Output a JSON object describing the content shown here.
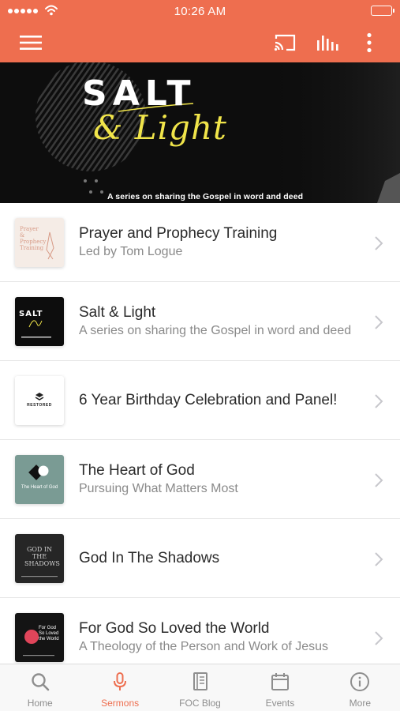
{
  "status_bar": {
    "time": "10:26 AM"
  },
  "banner": {
    "title": "SALT",
    "script": "& Light",
    "subtitle": "A series on sharing the Gospel in word and deed"
  },
  "sermons": [
    {
      "title": "Prayer and Prophecy Training",
      "subtitle": "Led by Tom Logue",
      "thumb_text": "Prayer & Prophecy Training"
    },
    {
      "title": "Salt & Light",
      "subtitle": "A series on sharing the Gospel in word and deed",
      "thumb_text": "SALT"
    },
    {
      "title": "6 Year Birthday Celebration and Panel!",
      "subtitle": "",
      "thumb_text": "RESTORED"
    },
    {
      "title": "The Heart of God",
      "subtitle": "Pursuing What Matters Most",
      "thumb_text": "The Heart of God"
    },
    {
      "title": "God In The Shadows",
      "subtitle": "",
      "thumb_text": "GOD IN THE SHADOWS"
    },
    {
      "title": "For God So Loved the World",
      "subtitle": "A Theology of the Person and Work of Jesus",
      "thumb_text": "For God So Loved the World"
    }
  ],
  "tabs": [
    {
      "label": "Home",
      "icon": "search-icon"
    },
    {
      "label": "Sermons",
      "icon": "microphone-icon"
    },
    {
      "label": "FOC Blog",
      "icon": "book-icon"
    },
    {
      "label": "Events",
      "icon": "calendar-icon"
    },
    {
      "label": "More",
      "icon": "info-icon"
    }
  ],
  "colors": {
    "accent": "#ee6e4f",
    "banner_script": "#f1e54a",
    "tab_inactive": "#8e8e8e"
  }
}
